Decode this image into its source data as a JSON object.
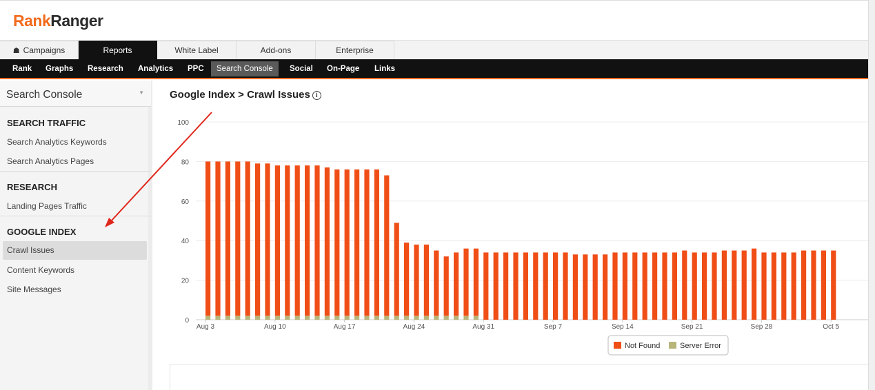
{
  "logo": {
    "part1": "Rank",
    "part2": "Ranger"
  },
  "tabs": [
    {
      "label": "Campaigns"
    },
    {
      "label": "Reports"
    },
    {
      "label": "White Label"
    },
    {
      "label": "Add-ons"
    },
    {
      "label": "Enterprise"
    }
  ],
  "subnav": [
    "Rank",
    "Graphs",
    "Research",
    "Analytics",
    "PPC",
    "Search Console",
    "Social",
    "On-Page",
    "Links"
  ],
  "sidebar": {
    "header": "Search Console",
    "sections": [
      {
        "title": "SEARCH TRAFFIC",
        "items": [
          "Search Analytics Keywords",
          "Search Analytics Pages"
        ]
      },
      {
        "title": "RESEARCH",
        "items": [
          "Landing Pages Traffic"
        ]
      },
      {
        "title": "GOOGLE INDEX",
        "items": [
          "Crawl Issues",
          "Content Keywords",
          "Site Messages"
        ]
      }
    ],
    "active_item": "Crawl Issues"
  },
  "page": {
    "title": "Google Index > Crawl Issues",
    "info_icon": "info-icon"
  },
  "colors": {
    "accent": "#f26b1d",
    "not_found": "#f04e17",
    "server_error": "#b8b57a"
  },
  "chart_data": {
    "type": "bar",
    "stacked": true,
    "ylim": [
      0,
      100
    ],
    "yticks": [
      0,
      20,
      40,
      60,
      80,
      100
    ],
    "x_tick_labels": [
      "Aug 3",
      "Aug 10",
      "Aug 17",
      "Aug 24",
      "Aug 31",
      "Sep 7",
      "Sep 14",
      "Sep 21",
      "Sep 28",
      "Oct 5"
    ],
    "first_date": "Aug 3",
    "grid": true,
    "legend_position": "bottom-center",
    "series": [
      {
        "name": "Not Found",
        "values": [
          78,
          78,
          78,
          78,
          78,
          77,
          77,
          76,
          76,
          76,
          76,
          76,
          75,
          74,
          74,
          74,
          74,
          74,
          71,
          47,
          37,
          36,
          36,
          33,
          30,
          32,
          34,
          34,
          34,
          34,
          34,
          34,
          34,
          34,
          34,
          34,
          34,
          33,
          33,
          33,
          33,
          34,
          34,
          34,
          34,
          34,
          34,
          34,
          35,
          34,
          34,
          34,
          35,
          35,
          35,
          36,
          34,
          34,
          34,
          34,
          35,
          35,
          35,
          35
        ]
      },
      {
        "name": "Server Error",
        "values": [
          2,
          2,
          2,
          2,
          2,
          2,
          2,
          2,
          2,
          2,
          2,
          2,
          2,
          2,
          2,
          2,
          2,
          2,
          2,
          2,
          2,
          2,
          2,
          2,
          2,
          2,
          2,
          2,
          0,
          0,
          0,
          0,
          0,
          0,
          0,
          0,
          0,
          0,
          0,
          0,
          0,
          0,
          0,
          0,
          0,
          0,
          0,
          0,
          0,
          0,
          0,
          0,
          0,
          0,
          0,
          0,
          0,
          0,
          0,
          0,
          0,
          0,
          0,
          0
        ]
      }
    ]
  }
}
